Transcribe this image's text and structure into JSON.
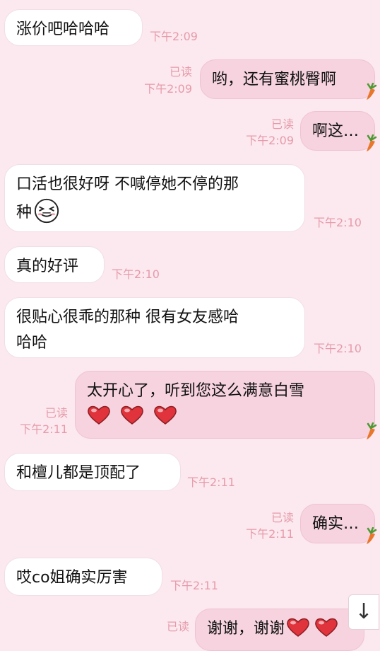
{
  "colors": {
    "background": "#fbe9ef",
    "incoming_bubble": "#ffffff",
    "outgoing_bubble": "#f6d3de",
    "meta_text": "#e79aaa",
    "heart": "#e0333c"
  },
  "messages": [
    {
      "dir": "in",
      "text": "涨价吧哈哈哈",
      "time": "下午2:09"
    },
    {
      "dir": "out",
      "text": "哟，还有蜜桃臀啊",
      "read": "已读",
      "time": "下午2:09"
    },
    {
      "dir": "out",
      "text": "啊这…",
      "read": "已读",
      "time": "下午2:09"
    },
    {
      "dir": "in",
      "text_line1": "口活也很好呀 不喊停她不停的那",
      "text_line2": "种",
      "emoji": "laughing-face-icon",
      "time": "下午2:10"
    },
    {
      "dir": "in",
      "text": "真的好评",
      "time": "下午2:10"
    },
    {
      "dir": "in",
      "text_line1": "很贴心很乖的那种 很有女友感哈",
      "text_line2": "哈哈",
      "time": "下午2:10"
    },
    {
      "dir": "out",
      "text": "太开心了，听到您这么满意白雪",
      "hearts": 3,
      "read": "已读",
      "time": "下午2:11"
    },
    {
      "dir": "in",
      "text": "和檀儿都是顶配了",
      "time": "下午2:11"
    },
    {
      "dir": "out",
      "text": "确实…",
      "read": "已读",
      "time": "下午2:11"
    },
    {
      "dir": "in",
      "text": "哎co姐确实厉害",
      "time": "下午2:11"
    },
    {
      "dir": "out",
      "text": "谢谢，谢谢",
      "hearts": 2,
      "read": "已读"
    }
  ],
  "scroll_button": {
    "icon": "arrow-down-icon",
    "glyph": "↓"
  }
}
